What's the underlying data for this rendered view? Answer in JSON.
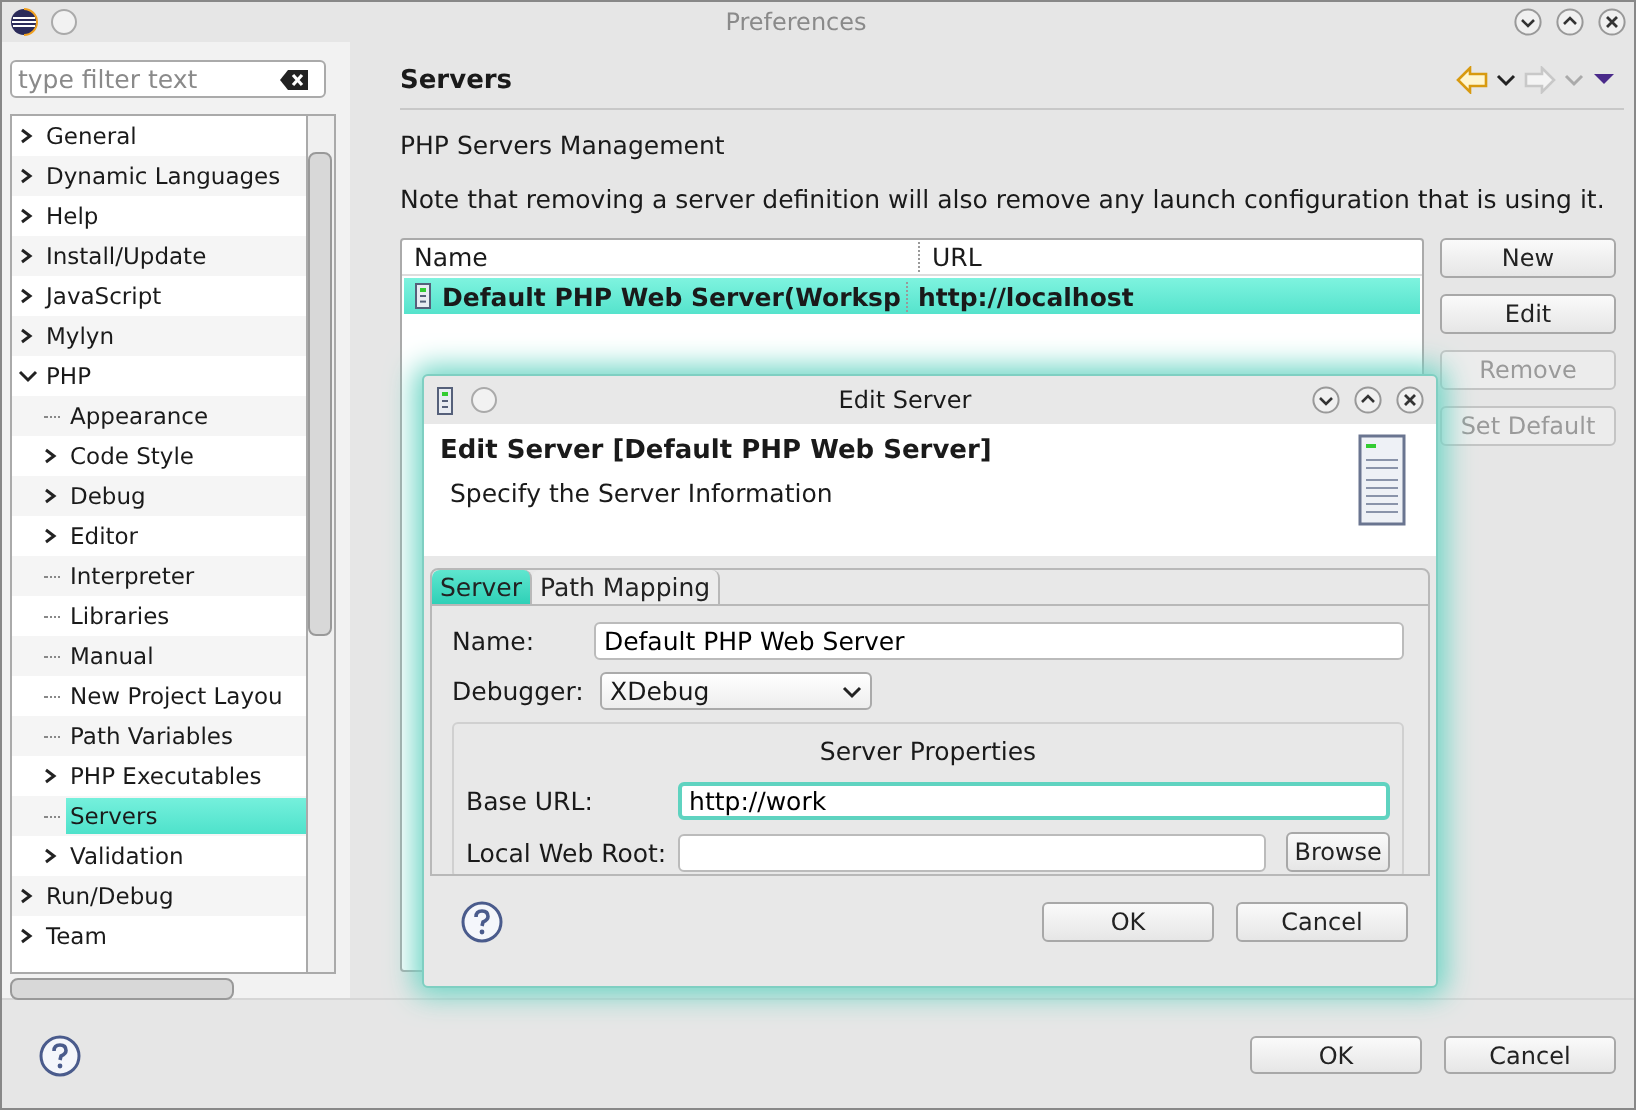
{
  "window": {
    "title": "Preferences"
  },
  "filter": {
    "placeholder": "type filter text"
  },
  "tree": [
    {
      "kind": "group",
      "label": "General",
      "expanded": false,
      "selected": false
    },
    {
      "kind": "group",
      "label": "Dynamic Languages",
      "expanded": false,
      "selected": false
    },
    {
      "kind": "group",
      "label": "Help",
      "expanded": false,
      "selected": false
    },
    {
      "kind": "group",
      "label": "Install/Update",
      "expanded": false,
      "selected": false
    },
    {
      "kind": "group",
      "label": "JavaScript",
      "expanded": false,
      "selected": false
    },
    {
      "kind": "group",
      "label": "Mylyn",
      "expanded": false,
      "selected": false
    },
    {
      "kind": "group",
      "label": "PHP",
      "expanded": true,
      "selected": false,
      "children": [
        {
          "kind": "leaf",
          "label": "Appearance",
          "selected": false
        },
        {
          "kind": "group",
          "label": "Code Style",
          "expanded": false,
          "selected": false
        },
        {
          "kind": "group",
          "label": "Debug",
          "expanded": false,
          "selected": false
        },
        {
          "kind": "group",
          "label": "Editor",
          "expanded": false,
          "selected": false
        },
        {
          "kind": "leaf",
          "label": "Interpreter",
          "selected": false
        },
        {
          "kind": "leaf",
          "label": "Libraries",
          "selected": false
        },
        {
          "kind": "leaf",
          "label": "Manual",
          "selected": false
        },
        {
          "kind": "leaf",
          "label": "New Project Layou",
          "selected": false
        },
        {
          "kind": "leaf",
          "label": "Path Variables",
          "selected": false
        },
        {
          "kind": "group",
          "label": "PHP Executables",
          "expanded": false,
          "selected": false
        },
        {
          "kind": "leaf",
          "label": "Servers",
          "selected": true
        },
        {
          "kind": "group",
          "label": "Validation",
          "expanded": false,
          "selected": false
        }
      ]
    },
    {
      "kind": "group",
      "label": "Run/Debug",
      "expanded": false,
      "selected": false
    },
    {
      "kind": "group",
      "label": "Team",
      "expanded": false,
      "selected": false
    }
  ],
  "page": {
    "title": "Servers",
    "subtitle": "PHP Servers Management",
    "note": "Note that removing a server definition will also remove any launch configuration that is using it.",
    "table": {
      "columns": [
        "Name",
        "URL"
      ],
      "rows": [
        {
          "name": "Default PHP Web Server(Worksp",
          "url": "http://localhost",
          "selected": true
        }
      ]
    },
    "buttons": [
      {
        "label": "New",
        "disabled": false
      },
      {
        "label": "Edit",
        "disabled": false
      },
      {
        "label": "Remove",
        "disabled": true
      },
      {
        "label": "Set Default",
        "disabled": true
      }
    ]
  },
  "footer": {
    "buttons": [
      "OK",
      "Cancel"
    ]
  },
  "dialog": {
    "title": "Edit Server",
    "heading": "Edit Server [Default PHP Web Server]",
    "description": "Specify the Server Information",
    "tabs": [
      {
        "label": "Server",
        "selected": true
      },
      {
        "label": "Path Mapping",
        "selected": false
      }
    ],
    "name_label": "Name:",
    "name_value": "Default PHP Web Server",
    "debugger_label": "Debugger:",
    "debugger_value": "XDebug",
    "group_title": "Server Properties",
    "base_url_label": "Base URL:",
    "base_url_value": "http://work",
    "web_root_label": "Local Web Root:",
    "browse": "Browse",
    "buttons": [
      "OK",
      "Cancel"
    ]
  }
}
